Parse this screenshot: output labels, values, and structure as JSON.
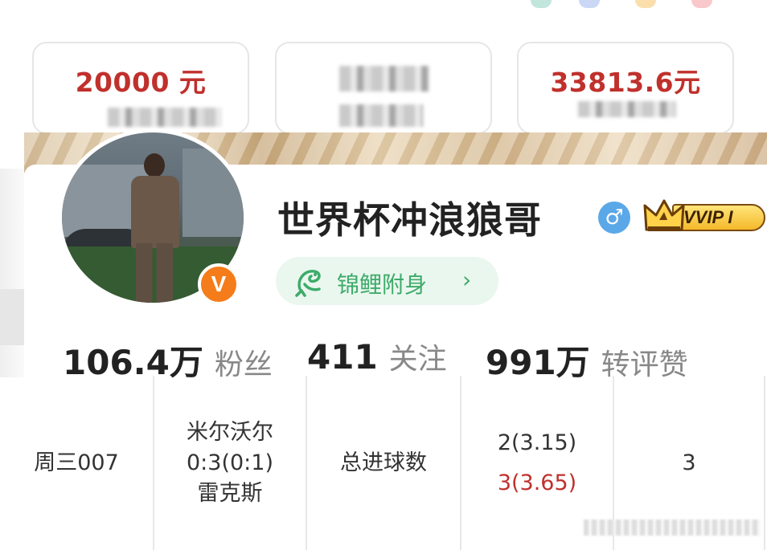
{
  "cards": [
    {
      "amount": "20000 元"
    },
    {
      "amount": ""
    },
    {
      "amount": "33813.6元"
    }
  ],
  "profile": {
    "username": "世界杯冲浪狼哥",
    "gender_symbol": "♂",
    "verified_badge": "V",
    "vip_label": "VVIP I",
    "koi_label": "锦鲤附身",
    "koi_chevron": "›",
    "stats": [
      {
        "value": "106.4万",
        "label": "粉丝"
      },
      {
        "value": "411",
        "label": "关注"
      },
      {
        "value": "991万",
        "label": "转评赞"
      }
    ]
  },
  "bet_row": {
    "match_id": "周三007",
    "match_lines": [
      "米尔沃尔",
      "0:3(0:1)",
      "雷克斯"
    ],
    "market": "总进球数",
    "picks": [
      {
        "text": "2(3.15)",
        "color": "#333333"
      },
      {
        "text": "3(3.65)",
        "color": "#c0302c"
      }
    ],
    "amount": "3"
  },
  "colors": {
    "amount_red": "#c0302c",
    "koi_green": "#3dab6a",
    "verified_orange": "#f57c1a",
    "gender_blue": "#5aa8e8",
    "vip_gold": "#f5b82a"
  }
}
